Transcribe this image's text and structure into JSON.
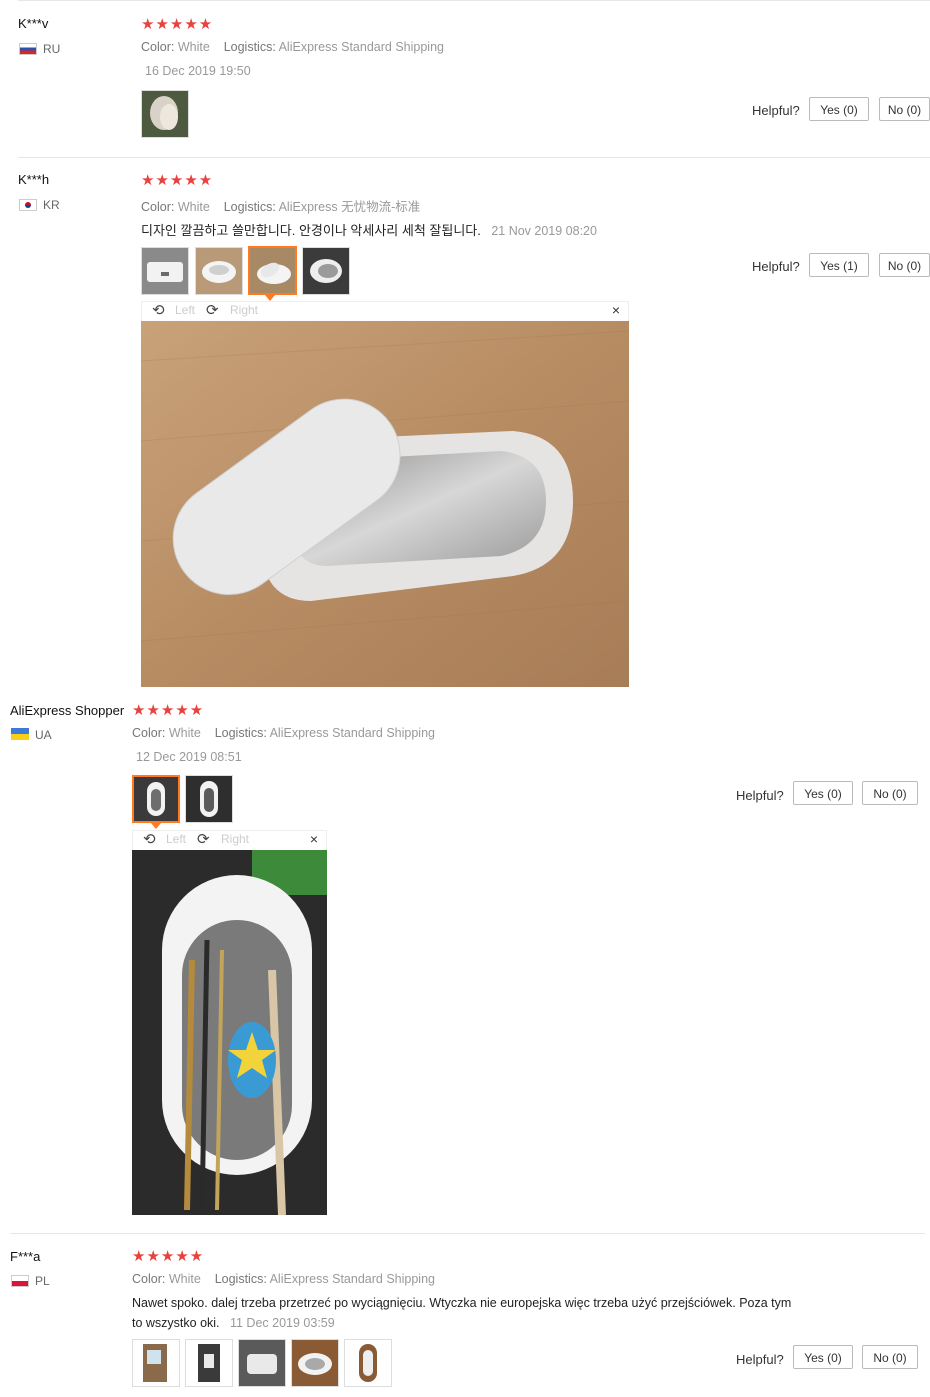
{
  "reviews": [
    {
      "user": "K***v",
      "country": "RU",
      "rating": "★★★★★",
      "color_label": "Color:",
      "color_value": "White",
      "logistics_label": "Logistics:",
      "logistics_value": "AliExpress Standard Shipping",
      "date": "16 Dec 2019 19:50",
      "helpful": "Helpful?",
      "yes": "Yes (0)",
      "no": "No (0)"
    },
    {
      "user": "K***h",
      "country": "KR",
      "rating": "★★★★★",
      "color_label": "Color:",
      "color_value": "White",
      "logistics_label": "Logistics:",
      "logistics_value": "AliExpress 无忧物流-标准",
      "text": "디자인 깔끔하고 쓸만합니다. 안경이나 악세사리 세척 잘됩니다.",
      "date": "21 Nov 2019 08:20",
      "helpful": "Helpful?",
      "yes": "Yes (1)",
      "no": "No (0)",
      "viewer": {
        "left": "Left",
        "right": "Right",
        "close": "×"
      }
    },
    {
      "user": "AliExpress Shopper",
      "country": "UA",
      "rating": "★★★★★",
      "color_label": "Color:",
      "color_value": "White",
      "logistics_label": "Logistics:",
      "logistics_value": "AliExpress Standard Shipping",
      "date": "12 Dec 2019 08:51",
      "helpful": "Helpful?",
      "yes": "Yes (0)",
      "no": "No (0)",
      "viewer": {
        "left": "Left",
        "right": "Right",
        "close": "×"
      }
    },
    {
      "user": "F***a",
      "country": "PL",
      "rating": "★★★★★",
      "color_label": "Color:",
      "color_value": "White",
      "logistics_label": "Logistics:",
      "logistics_value": "AliExpress Standard Shipping",
      "text_line1": "Nawet spoko. dalej trzeba przetrzeć po wyciągnięciu. Wtyczka nie europejska więc trzeba użyć przejściówek. Poza tym",
      "text_line2": "to wszystko oki.",
      "date": "11 Dec 2019 03:59",
      "helpful": "Helpful?",
      "yes": "Yes (0)",
      "no": "No (0)"
    }
  ],
  "colors": {
    "star": "#e8423f",
    "selected_thumb": "#ff7a21",
    "divider": "#e6e6e6"
  }
}
